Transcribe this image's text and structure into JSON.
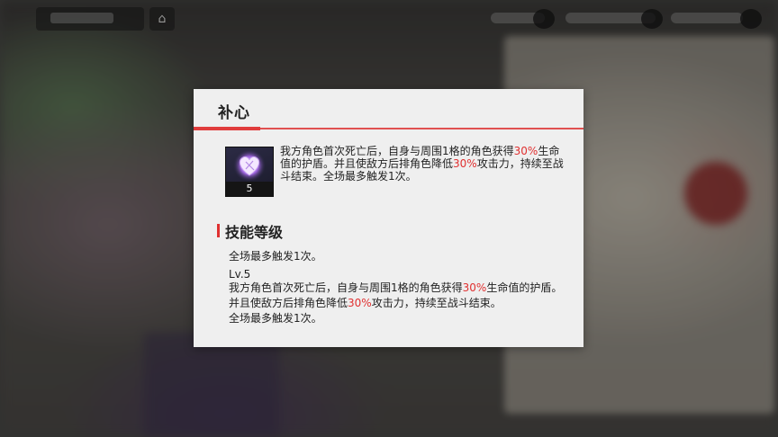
{
  "dialog": {
    "title": "补心",
    "skill_level_badge": "5",
    "description": {
      "part1": "我方角色首次死亡后，自身与周围1格的角色获得",
      "val1": "30%",
      "part2": "生命值的护盾。并且使敌方后排角色降低",
      "val2": "30%",
      "part3": "攻击力，持续至战斗结束。全场最多触发1次。"
    },
    "section_title": "技能等级",
    "note": "全场最多触发1次。",
    "level_label": "Lv.5",
    "level_detail": {
      "part1": "我方角色首次死亡后，自身与周围1格的角色获得",
      "val1": "30%",
      "part2": "生命值的护盾。并且使敌方后排角色降低",
      "val2": "30%",
      "part3": "攻击力，持续至战斗结束。",
      "part4": "全场最多触发1次。"
    }
  },
  "colors": {
    "accent": "#e03030",
    "dialog_bg": "#efefef",
    "text": "#222222"
  },
  "icons": {
    "skill": "purple-heart-icon",
    "hud_home": "home-icon"
  }
}
